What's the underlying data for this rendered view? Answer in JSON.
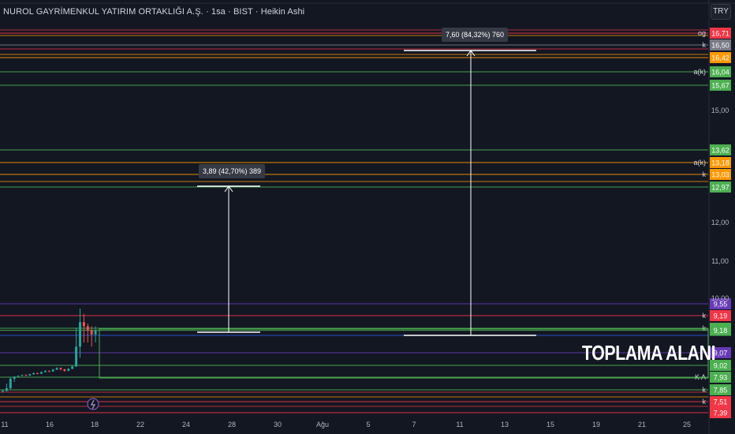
{
  "header": {
    "symbol_title": "NUROL GAYRİMENKUL YATIRIM ORTAKLIĞI A.Ş. · 1sa · BIST · Heikin Ashi",
    "currency": "TRY"
  },
  "annotations": {
    "zone_label": "TOPLAMA ALANI",
    "measure_1": "3,89 (42,70%) 389",
    "measure_2": "7,60 (84,32%) 760"
  },
  "colors": {
    "background": "#131722",
    "red": "#f23645",
    "green": "#4caf50",
    "orange": "#ff9800",
    "purple": "#673ab7",
    "gray": "#787b86",
    "text": "#d1d4dc"
  },
  "chart_data": {
    "type": "line",
    "ylim": [
      7.2,
      17.1
    ],
    "y_ticks": [
      "15,00",
      "12,00",
      "11,00",
      "10,00"
    ],
    "y_tick_values": [
      15.0,
      12.0,
      11.0,
      10.0
    ],
    "x_ticks": [
      "11",
      "16",
      "18",
      "22",
      "24",
      "28",
      "30",
      "Ağu",
      "5",
      "7",
      "11",
      "13",
      "15",
      "19",
      "21",
      "25"
    ],
    "price_tags": [
      {
        "label": "16,71",
        "value": 16.71,
        "color": "#f23645",
        "text": "og"
      },
      {
        "label": "16,50",
        "value": 16.5,
        "color": "#787b86",
        "text": "k"
      },
      {
        "label": "16,42",
        "value": 16.42,
        "color": "#ff9800",
        "text": ""
      },
      {
        "label": "16,04",
        "value": 16.04,
        "color": "#4caf50",
        "text": "a(k)"
      },
      {
        "label": "15,67",
        "value": 15.67,
        "color": "#4caf50",
        "text": ""
      },
      {
        "label": "13,62",
        "value": 13.62,
        "color": "#4caf50",
        "text": ""
      },
      {
        "label": "13,18",
        "value": 13.18,
        "color": "#ff9800",
        "text": "a(k)"
      },
      {
        "label": "13,03",
        "value": 13.03,
        "color": "#ff9800",
        "text": "k"
      },
      {
        "label": "12,97",
        "value": 12.97,
        "color": "#4caf50",
        "text": ""
      },
      {
        "label": "9,55",
        "value": 9.55,
        "color": "#673ab7",
        "text": ""
      },
      {
        "label": "9,19",
        "value": 9.19,
        "color": "#f23645",
        "text": "k"
      },
      {
        "label": "9,19",
        "value": 9.19,
        "color": "#4caf50",
        "text": "k"
      },
      {
        "label": "9,18",
        "value": 9.18,
        "color": "#4caf50",
        "text": ""
      },
      {
        "label": "9,07",
        "value": 9.07,
        "color": "#673ab7",
        "text": ""
      },
      {
        "label": "9,02",
        "value": 9.02,
        "color": "#4caf50",
        "text": ""
      },
      {
        "label": "7,93",
        "value": 7.93,
        "color": "#4caf50",
        "text": "K A"
      },
      {
        "label": "7,85",
        "value": 7.85,
        "color": "#4caf50",
        "text": "k"
      },
      {
        "label": "7,51",
        "value": 7.51,
        "color": "#f23645",
        "text": "k"
      },
      {
        "label": "7,39",
        "value": 7.39,
        "color": "#f23645",
        "text": ""
      }
    ],
    "candles": [
      {
        "o": 7.8,
        "c": 7.82,
        "h": 7.85,
        "l": 7.77
      },
      {
        "o": 7.82,
        "c": 7.86,
        "h": 7.89,
        "l": 7.8
      },
      {
        "o": 7.86,
        "c": 7.92,
        "h": 7.95,
        "l": 7.84
      },
      {
        "o": 7.92,
        "c": 7.98,
        "h": 8.02,
        "l": 7.9
      },
      {
        "o": 7.98,
        "c": 8.05,
        "h": 8.1,
        "l": 7.96
      },
      {
        "o": 8.05,
        "c": 8.12,
        "h": 8.18,
        "l": 8.02
      },
      {
        "o": 8.12,
        "c": 8.08,
        "h": 8.2,
        "l": 8.03
      },
      {
        "o": 8.08,
        "c": 8.2,
        "h": 8.25,
        "l": 8.05
      },
      {
        "o": 8.2,
        "c": 8.3,
        "h": 8.38,
        "l": 8.16
      },
      {
        "o": 8.3,
        "c": 8.26,
        "h": 8.36,
        "l": 8.2
      },
      {
        "o": 8.26,
        "c": 8.4,
        "h": 8.45,
        "l": 8.22
      },
      {
        "o": 8.4,
        "c": 8.5,
        "h": 8.58,
        "l": 8.36
      },
      {
        "o": 8.5,
        "c": 8.46,
        "h": 8.56,
        "l": 8.4
      },
      {
        "o": 8.46,
        "c": 8.62,
        "h": 8.7,
        "l": 8.42
      },
      {
        "o": 8.62,
        "c": 8.78,
        "h": 8.85,
        "l": 8.58
      },
      {
        "o": 8.78,
        "c": 8.66,
        "h": 8.82,
        "l": 8.55
      },
      {
        "o": 8.66,
        "c": 8.52,
        "h": 8.7,
        "l": 8.42
      },
      {
        "o": 8.52,
        "c": 8.7,
        "h": 8.78,
        "l": 8.48
      },
      {
        "o": 8.7,
        "c": 8.92,
        "h": 9.0,
        "l": 8.66
      },
      {
        "o": 8.92,
        "c": 9.1,
        "h": 9.2,
        "l": 8.88
      },
      {
        "o": 9.1,
        "c": 9.28,
        "h": 9.48,
        "l": 9.05
      },
      {
        "o": 9.28,
        "c": 9.22,
        "h": 9.4,
        "l": 9.12
      },
      {
        "o": 9.22,
        "c": 9.18,
        "h": 9.26,
        "l": 9.12
      },
      {
        "o": 9.18,
        "c": 9.16,
        "h": 9.22,
        "l": 9.1
      },
      {
        "o": 9.16,
        "c": 9.18,
        "h": 9.22,
        "l": 9.12
      }
    ]
  }
}
